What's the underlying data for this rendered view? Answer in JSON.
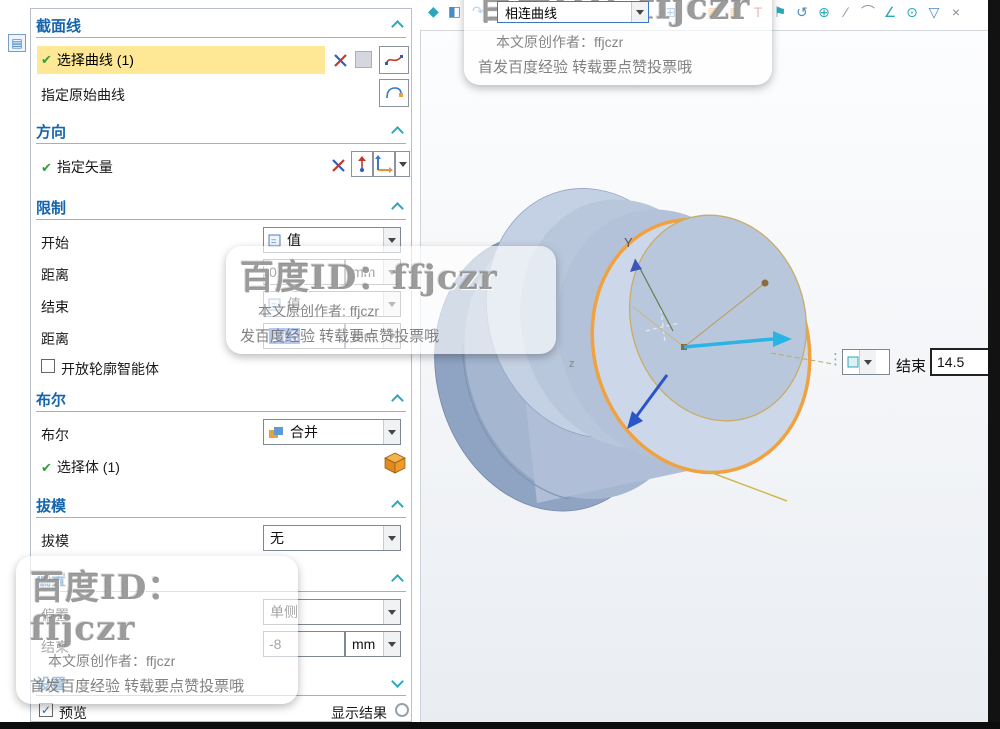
{
  "colors": {
    "header_blue": "#1565ad",
    "chevron_teal": "#2ba8bc",
    "highlight_yellow": "#ffe895",
    "selection_blue": "#3a6fe0",
    "edge_orange": "#f0a240",
    "check_green": "#2f9e3d"
  },
  "top_toolbar": {
    "curve_rule": {
      "value": "相连曲线"
    },
    "left_icons": [
      {
        "glyph": "◆"
      },
      {
        "glyph": "◧"
      },
      {
        "glyph": "↷"
      }
    ],
    "right_icons": [
      {
        "glyph": "⊞"
      },
      {
        "glyph": "≡"
      },
      {
        "glyph": "▦"
      },
      {
        "glyph": "▦"
      },
      {
        "glyph": "T"
      },
      {
        "glyph": "⚑"
      },
      {
        "glyph": "↺"
      },
      {
        "glyph": "⊕"
      },
      {
        "glyph": "∕"
      },
      {
        "glyph": "⌒"
      },
      {
        "glyph": "∠"
      },
      {
        "glyph": "⊙"
      },
      {
        "glyph": "▽"
      },
      {
        "glyph": "×"
      }
    ],
    "side_icon_glyph": "▤"
  },
  "panel": {
    "groups": {
      "section": {
        "title": "截面线"
      },
      "direction": {
        "title": "方向"
      },
      "limits": {
        "title": "限制"
      },
      "boolean": {
        "title": "布尔"
      },
      "draft": {
        "title": "拔模"
      },
      "offset": {
        "title": "偏置"
      },
      "settings": {
        "title": "设置"
      }
    },
    "rows": {
      "select_curve": {
        "check": "✔",
        "label": "选择曲线 (1)"
      },
      "origin_curve": {
        "label": "指定原始曲线"
      },
      "specify_vector": {
        "check": "✔",
        "label": "指定矢量"
      },
      "start": {
        "label": "开始",
        "value": "值"
      },
      "distance_start": {
        "label": "距离",
        "value": "0",
        "unit": "mm"
      },
      "end": {
        "label": "结束",
        "value": "值"
      },
      "distance_end": {
        "label": "距离",
        "value": "14.5",
        "unit": "mm"
      },
      "open_profile": {
        "label": "开放轮廓智能体"
      },
      "boolean": {
        "label": "布尔",
        "value": "合并"
      },
      "select_body": {
        "check": "✔",
        "label": "选择体 (1)"
      },
      "draft": {
        "label": "拔模",
        "value": "无"
      },
      "offset": {
        "label": "偏置",
        "value": "单侧"
      },
      "offset_end": {
        "label": "结束",
        "value": "-8",
        "unit": "mm"
      },
      "preview": {
        "check": "✓",
        "label": "预览"
      },
      "show_result": {
        "label": "显示结果"
      }
    }
  },
  "viewport": {
    "floating": {
      "label": "结束",
      "value": "14.5"
    },
    "axis_y_label": "Y",
    "axis_z_label": "z"
  },
  "watermarks": [
    {
      "big": "百度ID：ffjczr",
      "line1": "本文原创作者：ffjczr",
      "line2": "首发百度经验 转载要点赞投票哦"
    },
    {
      "big": "百度ID：ffjczr",
      "line1": "本文原创作者: ffjczr",
      "line2": "发百度经验 转载要点赞投票哦"
    },
    {
      "big": "百度ID：ffjczr",
      "line1": "本文原创作者：ffjczr",
      "line2": "首发百度经验 转载要点赞投票哦"
    }
  ]
}
